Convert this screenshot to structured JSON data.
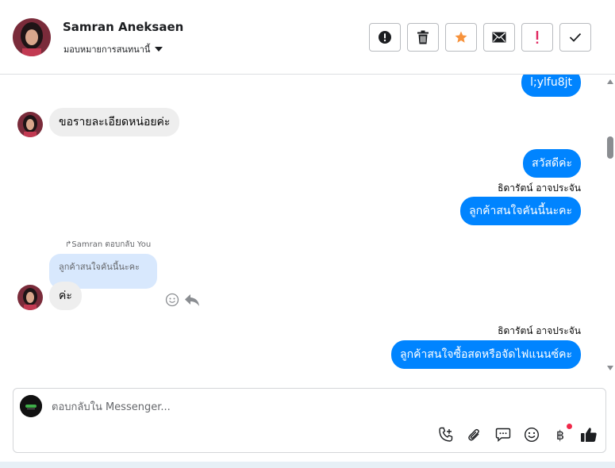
{
  "header": {
    "contact_name": "Samran Aneksaen",
    "assign_label": "มอบหมายการสนทนานี้",
    "actions": [
      {
        "name": "alert-button",
        "icon": "alert-circle-icon"
      },
      {
        "name": "delete-button",
        "icon": "trash-icon"
      },
      {
        "name": "star-button",
        "icon": "star-icon"
      },
      {
        "name": "mark-unread-button",
        "icon": "envelope-icon"
      },
      {
        "name": "spam-button",
        "icon": "exclamation-icon"
      },
      {
        "name": "mark-done-button",
        "icon": "check-icon"
      }
    ]
  },
  "messages": {
    "m1": "l;ylfu8jt",
    "m2": "ขอรายละเอียดหน่อยค่ะ",
    "m3": "สวัสดีค่ะ",
    "m4_sender": "ธิดารัตน์ อาจประจัน",
    "m4": "ลูกค้าสนใจคันนี้นะคะ",
    "m5_reply_meta": "Samran ตอบกลับ You",
    "m5_quoted": "ลูกค้าสนใจคันนี้นะคะ",
    "m5": "ค่ะ",
    "m6_sender": "ธิดารัตน์ อาจประจัน",
    "m6": "ลูกค้าสนใจซื้อสดหรือจัดไฟแนนซ์คะ"
  },
  "composer": {
    "placeholder": "ตอบกลับใน Messenger...",
    "value": "",
    "tools": [
      "phone-plus-icon",
      "paperclip-icon",
      "chat-bubble-icon",
      "emoji-icon",
      "baht-icon",
      "thumbs-up-icon"
    ],
    "baht_symbol": "฿"
  },
  "colors": {
    "accent": "#0084ff",
    "star": "#f7923b",
    "danger": "#e0245e",
    "incoming": "#eeeeee",
    "quoted": "#d8e8fd"
  }
}
